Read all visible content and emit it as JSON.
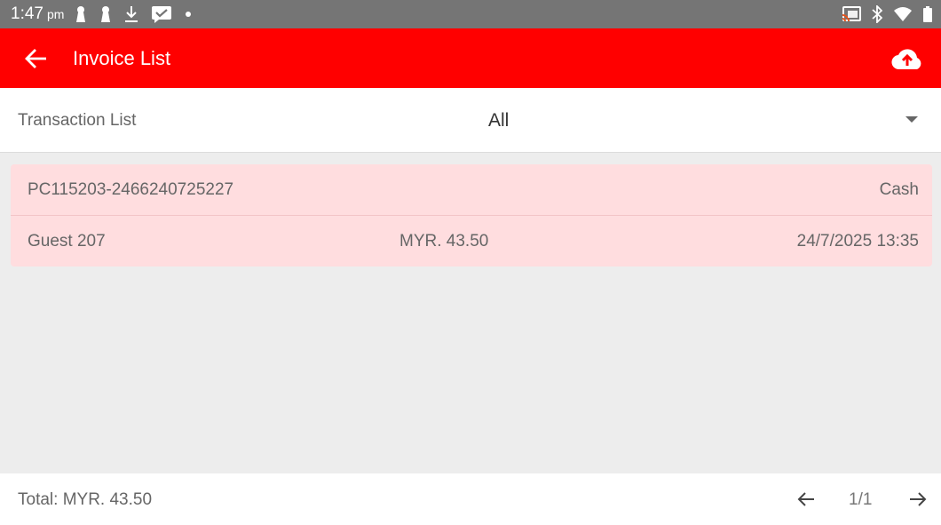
{
  "status_bar": {
    "time": "1:47",
    "ampm": "pm",
    "icons_left": [
      "keyhole-icon",
      "keyhole-icon",
      "download-icon",
      "message-icon",
      "dot-icon"
    ],
    "icons_right": [
      "cast-icon",
      "bluetooth-icon",
      "wifi-icon",
      "battery-icon"
    ]
  },
  "app_bar": {
    "title": "Invoice List",
    "back_icon": "arrow-back-icon",
    "action_icon": "cloud-upload-icon",
    "color": "#ff0000"
  },
  "filter": {
    "label": "Transaction List",
    "selected": "All"
  },
  "invoices": [
    {
      "invoice_no": "PC115203-2466240725227",
      "payment": "Cash",
      "customer": "Guest 207",
      "amount": "MYR. 43.50",
      "datetime": "24/7/2025 13:35"
    }
  ],
  "footer": {
    "total": "Total: MYR. 43.50",
    "page": "1/1"
  }
}
